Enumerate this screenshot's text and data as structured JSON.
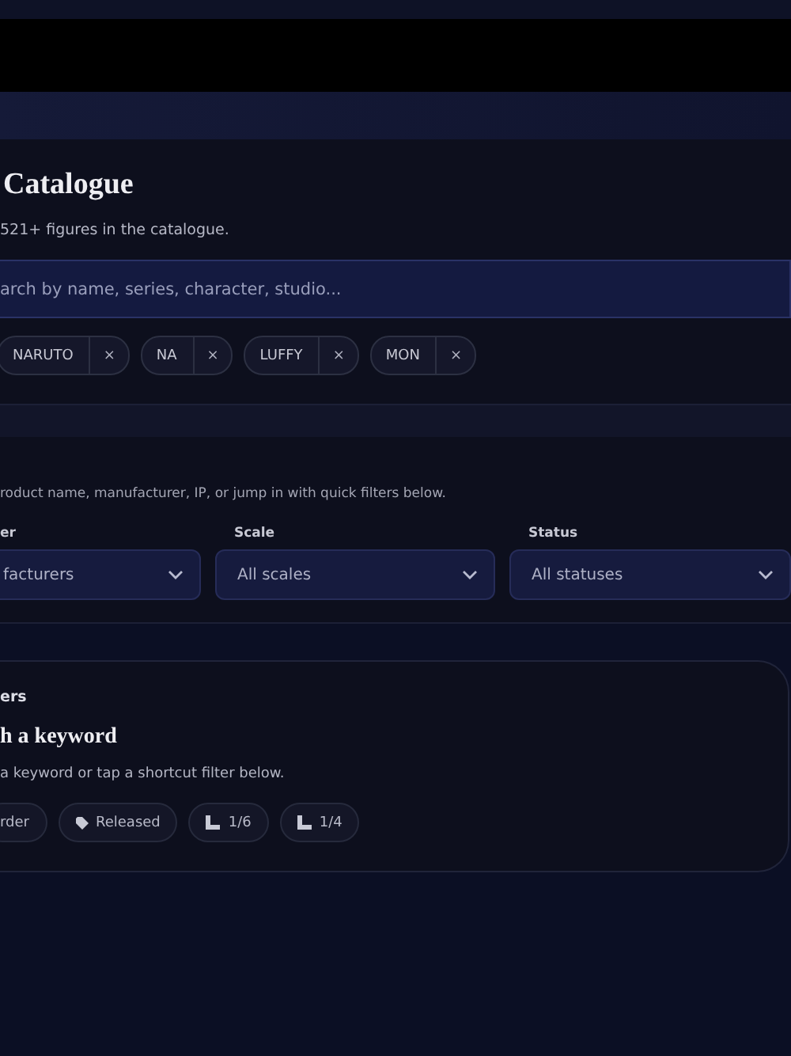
{
  "catalogue": {
    "title": "Catalogue",
    "subtitle": "521+ figures in the catalogue.",
    "search": {
      "placeholder": "arch by name, series, character, studio..."
    },
    "chips": [
      {
        "label": "NARUTO",
        "remove": "×"
      },
      {
        "label": "NA",
        "remove": "×"
      },
      {
        "label": "LUFFY",
        "remove": "×"
      },
      {
        "label": "MON",
        "remove": "×"
      }
    ]
  },
  "filters": {
    "hint": "roduct name, manufacturer, IP, or jump in with quick filters below.",
    "selects": [
      {
        "label": "er",
        "value": "facturers"
      },
      {
        "label": "Scale",
        "value": "All scales"
      },
      {
        "label": "Status",
        "value": "All statuses"
      }
    ]
  },
  "empty": {
    "eyebrow": "ers",
    "title": "h a keyword",
    "text": "a keyword or tap a shortcut filter below.",
    "shortcuts": [
      {
        "label": "rder",
        "kind": "plain"
      },
      {
        "label": "Released",
        "kind": "tag"
      },
      {
        "label": "1/6",
        "kind": "scale"
      },
      {
        "label": "1/4",
        "kind": "scale"
      }
    ]
  }
}
